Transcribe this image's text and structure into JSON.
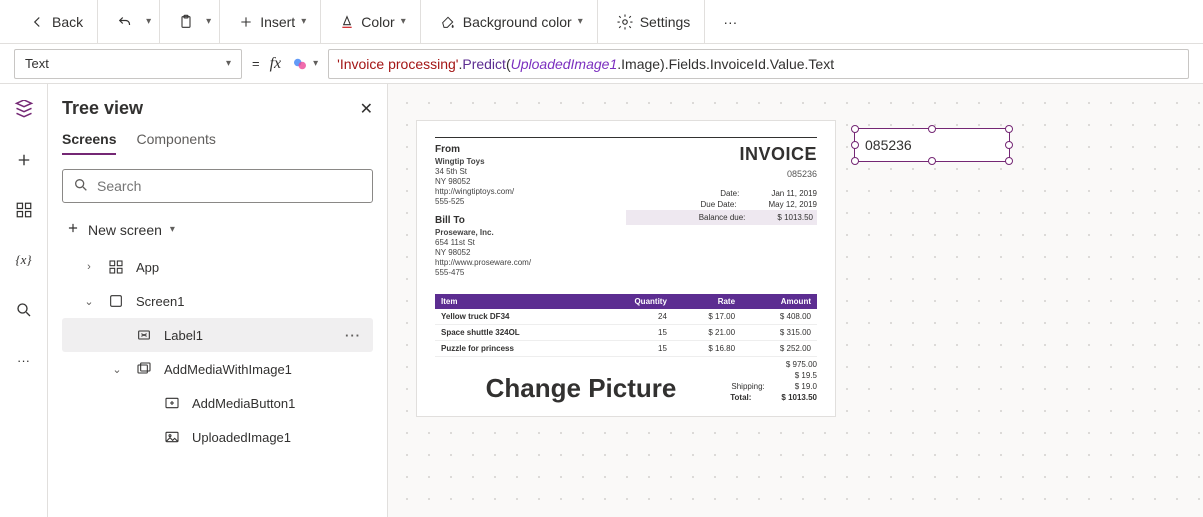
{
  "toolbar": {
    "back": "Back",
    "insert": "Insert",
    "color": "Color",
    "bgcolor": "Background color",
    "settings": "Settings"
  },
  "formula": {
    "property": "Text",
    "expr_parts": {
      "str": "'Invoice processing'",
      "dot1": ".",
      "func": "Predict",
      "open": "(",
      "id": "UploadedImage1",
      "after_id": ".Image)",
      "tail": ".Fields.InvoiceId.Value.Text"
    }
  },
  "tree": {
    "title": "Tree view",
    "tabs": {
      "screens": "Screens",
      "components": "Components"
    },
    "search_placeholder": "Search",
    "new_screen": "New screen",
    "items": {
      "app": "App",
      "screen": "Screen1",
      "label": "Label1",
      "media_grp": "AddMediaWithImage1",
      "media_btn": "AddMediaButton1",
      "uploaded": "UploadedImage1"
    }
  },
  "invoice": {
    "title": "INVOICE",
    "id": "085236",
    "from_label": "From",
    "from": {
      "company": "Wingtip Toys",
      "addr1": "34 5th St",
      "addr2": "NY 98052",
      "url": "http://wingtiptoys.com/",
      "phone": "555-525"
    },
    "bill_label": "Bill To",
    "bill": {
      "company": "Proseware, Inc.",
      "addr1": "654 11st St",
      "addr2": "NY 98052",
      "url": "http://www.proseware.com/",
      "phone": "555-475"
    },
    "meta": {
      "date_l": "Date:",
      "date_v": "Jan 11, 2019",
      "due_l": "Due Date:",
      "due_v": "May 12, 2019",
      "bal_l": "Balance due:",
      "bal_v": "$ 1013.50"
    },
    "cols": {
      "item": "Item",
      "qty": "Quantity",
      "rate": "Rate",
      "amt": "Amount"
    },
    "rows": [
      {
        "item": "Yellow truck DF34",
        "qty": "24",
        "rate": "$ 17.00",
        "amt": "$ 408.00"
      },
      {
        "item": "Space shuttle 324OL",
        "qty": "15",
        "rate": "$ 21.00",
        "amt": "$ 315.00"
      },
      {
        "item": "Puzzle for princess",
        "qty": "15",
        "rate": "$ 16.80",
        "amt": "$ 252.00"
      }
    ],
    "change_text": "Change Picture",
    "totals": {
      "sub": "$ 975.00",
      "v2": "$ 19.5",
      "ship_l": "Shipping:",
      "ship": "$ 19.0",
      "tot_l": "Total:",
      "tot": "$ 1013.50"
    }
  },
  "selected_value": "085236"
}
